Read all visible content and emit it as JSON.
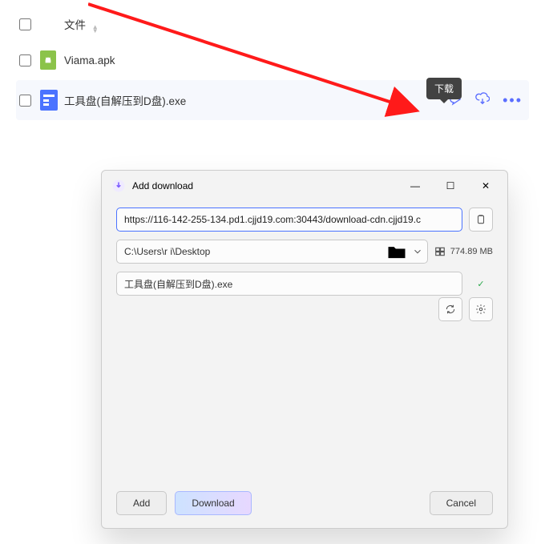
{
  "list": {
    "columns": {
      "file": "文件"
    },
    "tooltip": "下载",
    "rows": [
      {
        "name": "Viama.apk",
        "type": "apk",
        "selected": false
      },
      {
        "name": "工具盘(自解压到D盘).exe",
        "type": "exe",
        "selected": true,
        "actions": [
          "share",
          "download",
          "more"
        ]
      }
    ]
  },
  "dialog": {
    "title": "Add download",
    "url": "https://116-142-255-134.pd1.cjjd19.com:30443/download-cdn.cjjd19.c",
    "path": "C:\\Users\\r            i\\Desktop",
    "disk_space": "774.89 MB",
    "filename": "工具盘(自解压到D盘).exe",
    "buttons": {
      "add": "Add",
      "download": "Download",
      "cancel": "Cancel"
    }
  }
}
